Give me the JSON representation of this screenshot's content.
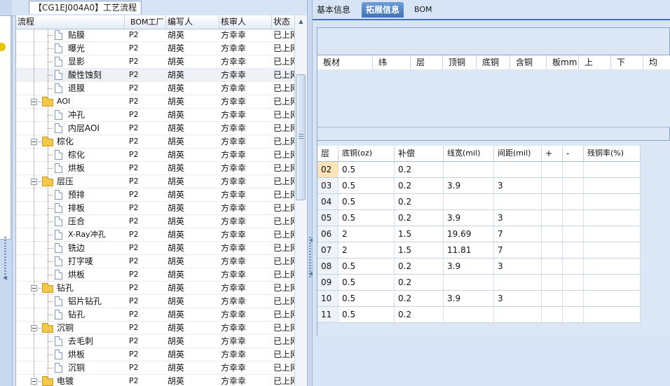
{
  "left_panel": {
    "tab_label": "【CG1EJ004A0】工艺流程",
    "columns": [
      "流程",
      "BOM工厂",
      "编写人",
      "核审人",
      "状态"
    ],
    "rows": [
      {
        "name": "贴膜",
        "type": "doc",
        "depth": 2,
        "bom": "P2",
        "writer": "胡英",
        "reviewer": "方幸幸",
        "status": "已上网"
      },
      {
        "name": "曝光",
        "type": "doc",
        "depth": 2,
        "bom": "P2",
        "writer": "胡英",
        "reviewer": "方幸幸",
        "status": "已上网"
      },
      {
        "name": "显影",
        "type": "doc",
        "depth": 2,
        "bom": "P2",
        "writer": "胡英",
        "reviewer": "方幸幸",
        "status": "已上网"
      },
      {
        "name": "酸性蚀刻",
        "type": "doc",
        "depth": 2,
        "bom": "P2",
        "writer": "胡英",
        "reviewer": "方幸幸",
        "status": "已上网",
        "selected": true
      },
      {
        "name": "退膜",
        "type": "doc",
        "depth": 2,
        "bom": "P2",
        "writer": "胡英",
        "reviewer": "方幸幸",
        "status": "已上网"
      },
      {
        "name": "AOI",
        "type": "folder",
        "depth": 1,
        "bom": "P2",
        "writer": "胡英",
        "reviewer": "方幸幸",
        "status": "已上网"
      },
      {
        "name": "冲孔",
        "type": "doc",
        "depth": 2,
        "bom": "P2",
        "writer": "胡英",
        "reviewer": "方幸幸",
        "status": "已上网"
      },
      {
        "name": "内层AOI",
        "type": "doc",
        "depth": 2,
        "bom": "P2",
        "writer": "胡英",
        "reviewer": "方幸幸",
        "status": "已上网"
      },
      {
        "name": "棕化",
        "type": "folder",
        "depth": 1,
        "bom": "P2",
        "writer": "胡英",
        "reviewer": "方幸幸",
        "status": "已上网"
      },
      {
        "name": "棕化",
        "type": "doc",
        "depth": 2,
        "bom": "P2",
        "writer": "胡英",
        "reviewer": "方幸幸",
        "status": "已上网"
      },
      {
        "name": "烘板",
        "type": "doc",
        "depth": 2,
        "bom": "P2",
        "writer": "胡英",
        "reviewer": "方幸幸",
        "status": "已上网"
      },
      {
        "name": "层压",
        "type": "folder",
        "depth": 1,
        "bom": "P2",
        "writer": "胡英",
        "reviewer": "方幸幸",
        "status": "已上网"
      },
      {
        "name": "预排",
        "type": "doc",
        "depth": 2,
        "bom": "P2",
        "writer": "胡英",
        "reviewer": "方幸幸",
        "status": "已上网"
      },
      {
        "name": "排板",
        "type": "doc",
        "depth": 2,
        "bom": "P2",
        "writer": "胡英",
        "reviewer": "方幸幸",
        "status": "已上网"
      },
      {
        "name": "压合",
        "type": "doc",
        "depth": 2,
        "bom": "P2",
        "writer": "胡英",
        "reviewer": "方幸幸",
        "status": "已上网"
      },
      {
        "name": "X-Ray冲孔",
        "type": "doc",
        "depth": 2,
        "bom": "P2",
        "writer": "胡英",
        "reviewer": "方幸幸",
        "status": "已上网"
      },
      {
        "name": "铣边",
        "type": "doc",
        "depth": 2,
        "bom": "P2",
        "writer": "胡英",
        "reviewer": "方幸幸",
        "status": "已上网"
      },
      {
        "name": "打字唛",
        "type": "doc",
        "depth": 2,
        "bom": "P2",
        "writer": "胡英",
        "reviewer": "方幸幸",
        "status": "已上网"
      },
      {
        "name": "烘板",
        "type": "doc",
        "depth": 2,
        "bom": "P2",
        "writer": "胡英",
        "reviewer": "方幸幸",
        "status": "已上网"
      },
      {
        "name": "钻孔",
        "type": "folder",
        "depth": 1,
        "bom": "P2",
        "writer": "胡英",
        "reviewer": "方幸幸",
        "status": "已上网"
      },
      {
        "name": "铝片钻孔",
        "type": "doc",
        "depth": 2,
        "bom": "P2",
        "writer": "胡英",
        "reviewer": "方幸幸",
        "status": "已上网"
      },
      {
        "name": "钻孔",
        "type": "doc",
        "depth": 2,
        "bom": "P2",
        "writer": "胡英",
        "reviewer": "方幸幸",
        "status": "已上网"
      },
      {
        "name": "沉铜",
        "type": "folder",
        "depth": 1,
        "bom": "P2",
        "writer": "胡英",
        "reviewer": "方幸幸",
        "status": "已上网"
      },
      {
        "name": "去毛刺",
        "type": "doc",
        "depth": 2,
        "bom": "P2",
        "writer": "胡英",
        "reviewer": "方幸幸",
        "status": "已上网"
      },
      {
        "name": "烘板",
        "type": "doc",
        "depth": 2,
        "bom": "P2",
        "writer": "胡英",
        "reviewer": "方幸幸",
        "status": "已上网"
      },
      {
        "name": "沉铜",
        "type": "doc",
        "depth": 2,
        "bom": "P2",
        "writer": "胡英",
        "reviewer": "方幸幸",
        "status": "已上网"
      },
      {
        "name": "电镀",
        "type": "folder",
        "depth": 1,
        "bom": "P2",
        "writer": "胡英",
        "reviewer": "方幸幸",
        "status": "已上网"
      }
    ]
  },
  "right_panel": {
    "tabs": [
      {
        "label": "基本信息",
        "active": false
      },
      {
        "label": "拓展信息",
        "active": true
      },
      {
        "label": "BOM",
        "active": false
      }
    ],
    "board_table": {
      "columns": [
        "板材",
        "纬",
        "层",
        "顶铜",
        "底铜",
        "含铜",
        "板mm",
        "上",
        "下",
        "均"
      ]
    },
    "layer_table": {
      "columns": [
        "层",
        "底铜(oz)",
        "补偿",
        "线宽(mil)",
        "间距(mil)",
        "+",
        "-",
        "残铜率(%)"
      ],
      "rows": [
        {
          "layer": "02",
          "base": "0.5",
          "comp": "0.2",
          "width": "",
          "spacing": "",
          "current": true
        },
        {
          "layer": "03",
          "base": "0.5",
          "comp": "0.2",
          "width": "3.9",
          "spacing": "3"
        },
        {
          "layer": "04",
          "base": "0.5",
          "comp": "0.2",
          "width": "",
          "spacing": ""
        },
        {
          "layer": "05",
          "base": "0.5",
          "comp": "0.2",
          "width": "3.9",
          "spacing": "3"
        },
        {
          "layer": "06",
          "base": "2",
          "comp": "1.5",
          "width": "19.69",
          "spacing": "7"
        },
        {
          "layer": "07",
          "base": "2",
          "comp": "1.5",
          "width": "11.81",
          "spacing": "7"
        },
        {
          "layer": "08",
          "base": "0.5",
          "comp": "0.2",
          "width": "3.9",
          "spacing": "3"
        },
        {
          "layer": "09",
          "base": "0.5",
          "comp": "0.2",
          "width": "",
          "spacing": ""
        },
        {
          "layer": "10",
          "base": "0.5",
          "comp": "0.2",
          "width": "3.9",
          "spacing": "3"
        },
        {
          "layer": "11",
          "base": "0.5",
          "comp": "0.2",
          "width": "",
          "spacing": ""
        }
      ]
    }
  }
}
